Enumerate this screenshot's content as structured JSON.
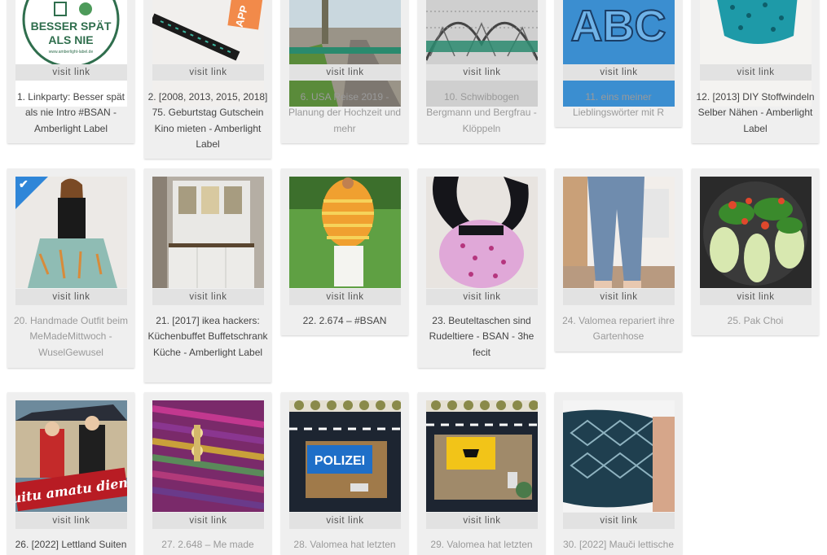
{
  "gallery": {
    "visit_label": "visit link",
    "items": [
      {
        "id": "1",
        "title": "1. Linkparty: Besser spät als nie Intro #BSAN - Amberlight Label",
        "visited": false,
        "thumb_text": [
          "BESSER SPÄT",
          "ALS NIE",
          "www.amberlight-label.de"
        ]
      },
      {
        "id": "2",
        "title": "2. [2008, 2013, 2015, 2018] 75. Geburtstag Gutschein Kino mieten - Amberlight Label",
        "visited": false,
        "thumb_text": [
          "APP"
        ]
      },
      {
        "id": "6",
        "title": "6. USA Reise 2019 - Planung der Hochzeit und mehr",
        "visited": true
      },
      {
        "id": "10",
        "title": "10. Schwibbogen Bergmann und Bergfrau - Klöppeln",
        "visited": true
      },
      {
        "id": "11",
        "title": "11. eins meiner Lieblingswörter mit R",
        "visited": true,
        "thumb_text": [
          "ABC"
        ]
      },
      {
        "id": "12",
        "title": "12. [2013] DIY Stoffwindeln Selber Nähen - Amberlight Label",
        "visited": false
      },
      {
        "id": "20",
        "title": "20. Handmade Outfit beim MeMadeMittwoch - WuselGewusel",
        "visited": true,
        "checked": true
      },
      {
        "id": "21",
        "title": "21. [2017] ikea hackers: Küchenbuffet Buffetschrank Küche - Amberlight Label",
        "visited": false
      },
      {
        "id": "22",
        "title": "22. 2.674 – #BSAN",
        "visited": false
      },
      {
        "id": "23",
        "title": "23. Beuteltaschen sind Rudeltiere - BSAN - 3he fecit",
        "visited": false
      },
      {
        "id": "24",
        "title": "24. Valomea repariert ihre Gartenhose",
        "visited": true
      },
      {
        "id": "25",
        "title": "25. Pak Choi",
        "visited": true
      },
      {
        "id": "26",
        "title": "26. [2022] Lettland Suiten",
        "visited": false,
        "thumb_text": [
          "Suitu amatu diena"
        ]
      },
      {
        "id": "27",
        "title": "27. 2.648 – Me made",
        "visited": true
      },
      {
        "id": "28",
        "title": "28. Valomea hat letzten",
        "visited": true,
        "thumb_text": [
          "POLIZEI"
        ]
      },
      {
        "id": "29",
        "title": "29. Valomea hat letzten",
        "visited": true
      },
      {
        "id": "30",
        "title": "30. [2022] Mauči lettische",
        "visited": true
      }
    ]
  },
  "colors": {
    "card_bg": "#efefef",
    "bar_bg": "#e2e2e2",
    "visited_text": "#9a9a9a",
    "text": "#444444",
    "check": "#2f86d8"
  }
}
